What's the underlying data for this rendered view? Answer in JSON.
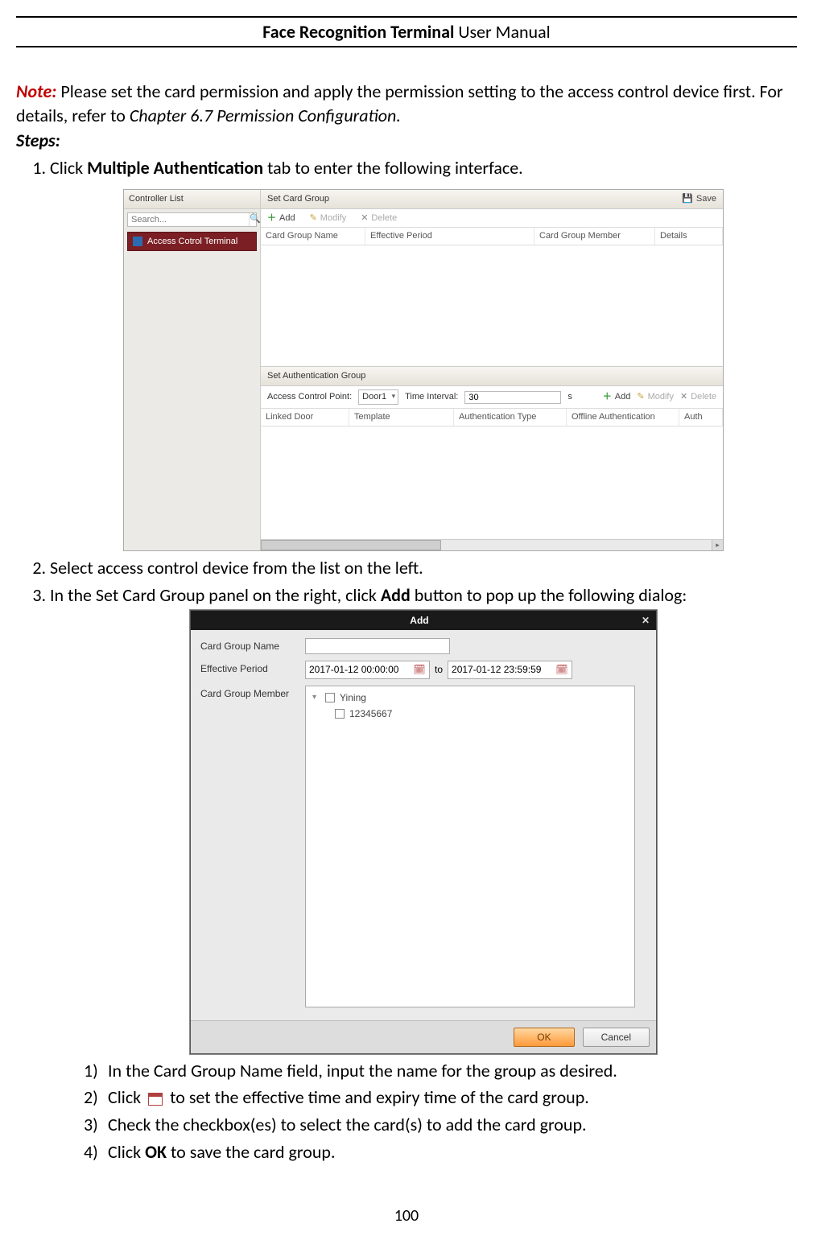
{
  "header": {
    "bold": "Face Recognition Terminal",
    "plain": " User Manual"
  },
  "pageNumber": "100",
  "note": {
    "label": "Note:",
    "text_a": " Please set the card permission and apply the permission setting to the access control device first. For details, refer to ",
    "italic": "Chapter 6.7 Permission Configuration.",
    "steps_label": "Steps:"
  },
  "steps": {
    "s1_a": "Click ",
    "s1_bold": "Multiple Authentication",
    "s1_b": " tab to enter the following interface.",
    "s2": "Select access control device from the list on the left.",
    "s3_a": "In the Set Card Group panel on the right, click ",
    "s3_bold": "Add",
    "s3_b": " button to pop up the following dialog:",
    "sub1": "In the Card Group Name field, input the name for the group as desired.",
    "sub2_a": "Click ",
    "sub2_b": " to set the effective time and expiry time of the card group.",
    "sub3": "Check the checkbox(es) to select the card(s) to add the card group.",
    "sub4_a": "Click ",
    "sub4_bold": "OK",
    "sub4_b": " to save the card group."
  },
  "shot1": {
    "controllerList": "Controller List",
    "searchPlaceholder": "Search...",
    "device": "Access Cotrol Terminal",
    "setCardGroup": "Set Card Group",
    "save": "Save",
    "add": "Add",
    "modify": "Modify",
    "delete": "Delete",
    "cols1": {
      "c1": "Card Group Name",
      "c2": "Effective Period",
      "c3": "Card Group Member",
      "c4": "Details"
    },
    "setAuthGroup": "Set Authentication Group",
    "acpLabel": "Access Control Point:",
    "acpValue": "Door1",
    "tiLabel": "Time Interval:",
    "tiValue": "30",
    "tiUnit": "s",
    "cols2": {
      "c1": "Linked Door",
      "c2": "Template",
      "c3": "Authentication Type",
      "c4": "Offline Authentication",
      "c5": "Auth"
    }
  },
  "shot2": {
    "title": "Add",
    "cardGroupNameLabel": "Card Group Name",
    "effectivePeriodLabel": "Effective Period",
    "dateFrom": "2017-01-12 00:00:00",
    "dateTo": "2017-01-12 23:59:59",
    "cardGroupMemberLabel": "Card Group Member",
    "tree": {
      "parent": "Yining",
      "child": "12345667"
    },
    "ok": "OK",
    "cancel": "Cancel"
  }
}
